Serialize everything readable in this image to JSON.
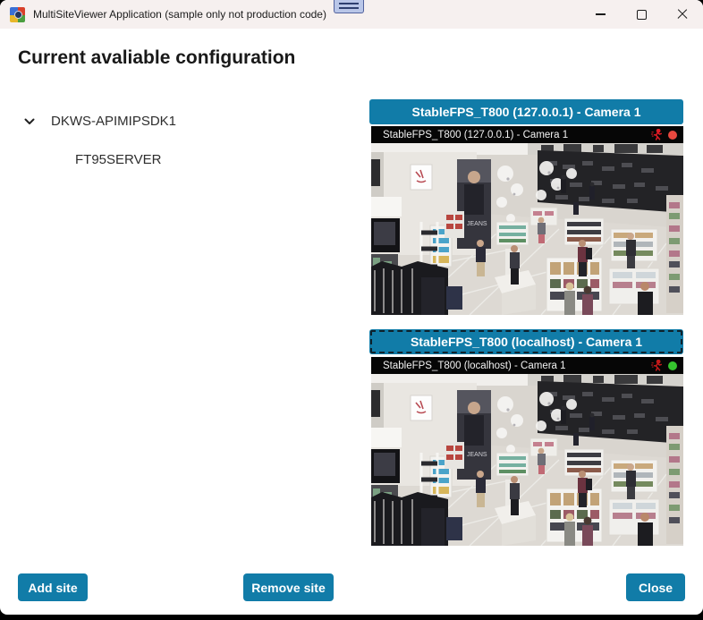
{
  "window": {
    "title": "MultiSiteViewer Application (sample only not production code)",
    "controls": {
      "minimize": "minimize",
      "maximize": "maximize",
      "close": "close"
    }
  },
  "heading": "Current avaliable configuration",
  "tree": {
    "root_label": "DKWS-APIMIPSDK1",
    "child_label": "FT95SERVER",
    "root_expanded": true
  },
  "cameras": [
    {
      "header_label": "StableFPS_T800 (127.0.0.1) - Camera 1",
      "overlay_label": "StableFPS_T800 (127.0.0.1) - Camera 1",
      "motion_icon_color": "#e01b24",
      "status_dot_color": "#e8483f",
      "selected": false
    },
    {
      "header_label": "StableFPS_T800 (localhost) - Camera 1",
      "overlay_label": "StableFPS_T800 (localhost) - Camera 1",
      "motion_icon_color": "#c41a1a",
      "status_dot_color": "#35c42e",
      "selected": true
    }
  ],
  "buttons": {
    "add_site": "Add site",
    "remove_site": "Remove site",
    "close": "Close"
  },
  "colors": {
    "accent_blue": "#117CA8",
    "titlebar_bg": "#f6f0ef",
    "record_red": "#e8483f",
    "record_green": "#35c42e"
  }
}
